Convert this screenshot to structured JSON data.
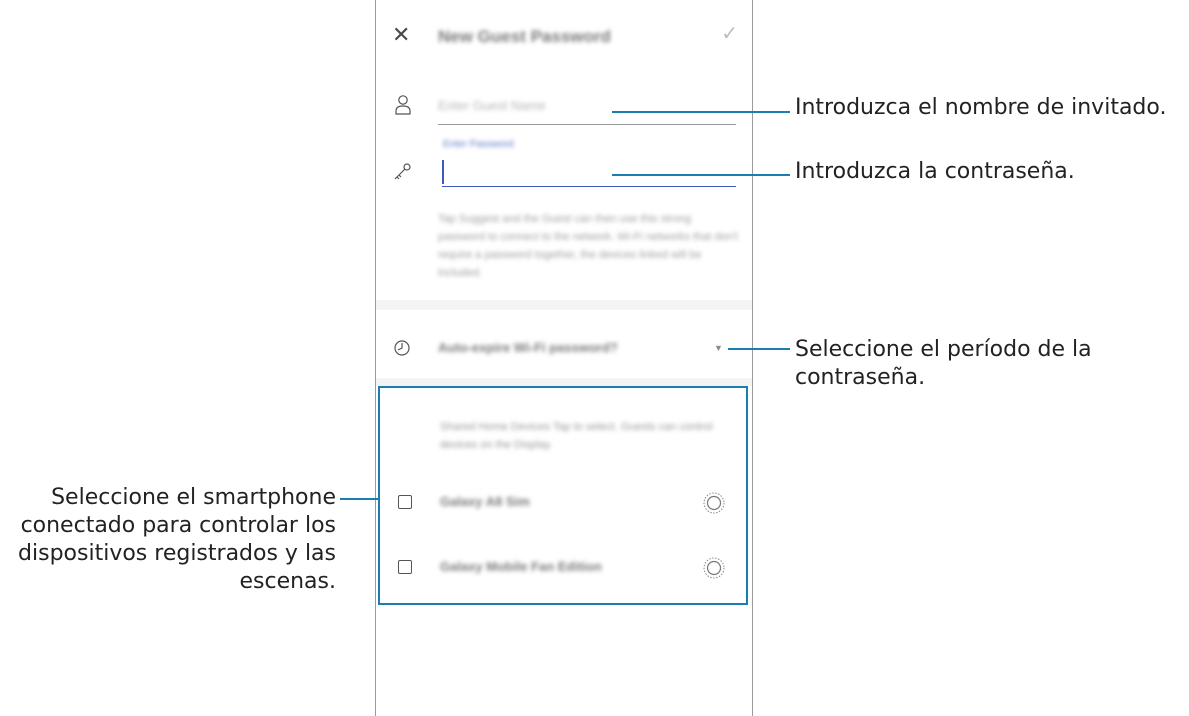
{
  "screen": {
    "title": "New Guest Password",
    "close_icon": "close-icon",
    "confirm_icon": "check-icon",
    "guest_name": {
      "icon": "person-icon",
      "placeholder": "Enter Guest Name"
    },
    "password": {
      "icon": "key-icon",
      "label": "Enter Password",
      "value": ""
    },
    "description": "Tap Suggest and the Guest can then use this strong password to connect to the network. Wi-Fi networks that don't require a password together, the devices linked will be included.",
    "period": {
      "icon": "clock-icon",
      "label": "Auto-expire Wi-Fi password?",
      "arrow_icon": "dropdown-arrow-icon"
    },
    "devices": {
      "header": "Shared Home Devices  Tap to select. Guests can control devices on the Display.",
      "items": [
        {
          "name": "Galaxy A8 Sim",
          "checked": false,
          "icon": "radio-ring-icon"
        },
        {
          "name": "Galaxy Mobile Fan Edition",
          "checked": false,
          "icon": "radio-ring-icon"
        }
      ]
    }
  },
  "callouts": {
    "guest_name": "Introduzca el nombre de invitado.",
    "password": "Introduzca la contraseña.",
    "period": "Seleccione el período de la contraseña.",
    "devices": "Seleccione el smartphone conectado para controlar los dispositivos registrados y las escenas."
  },
  "colors": {
    "accent": "#1a7fb0",
    "input_active": "#3a5bb8",
    "label": "#5b77c8"
  }
}
